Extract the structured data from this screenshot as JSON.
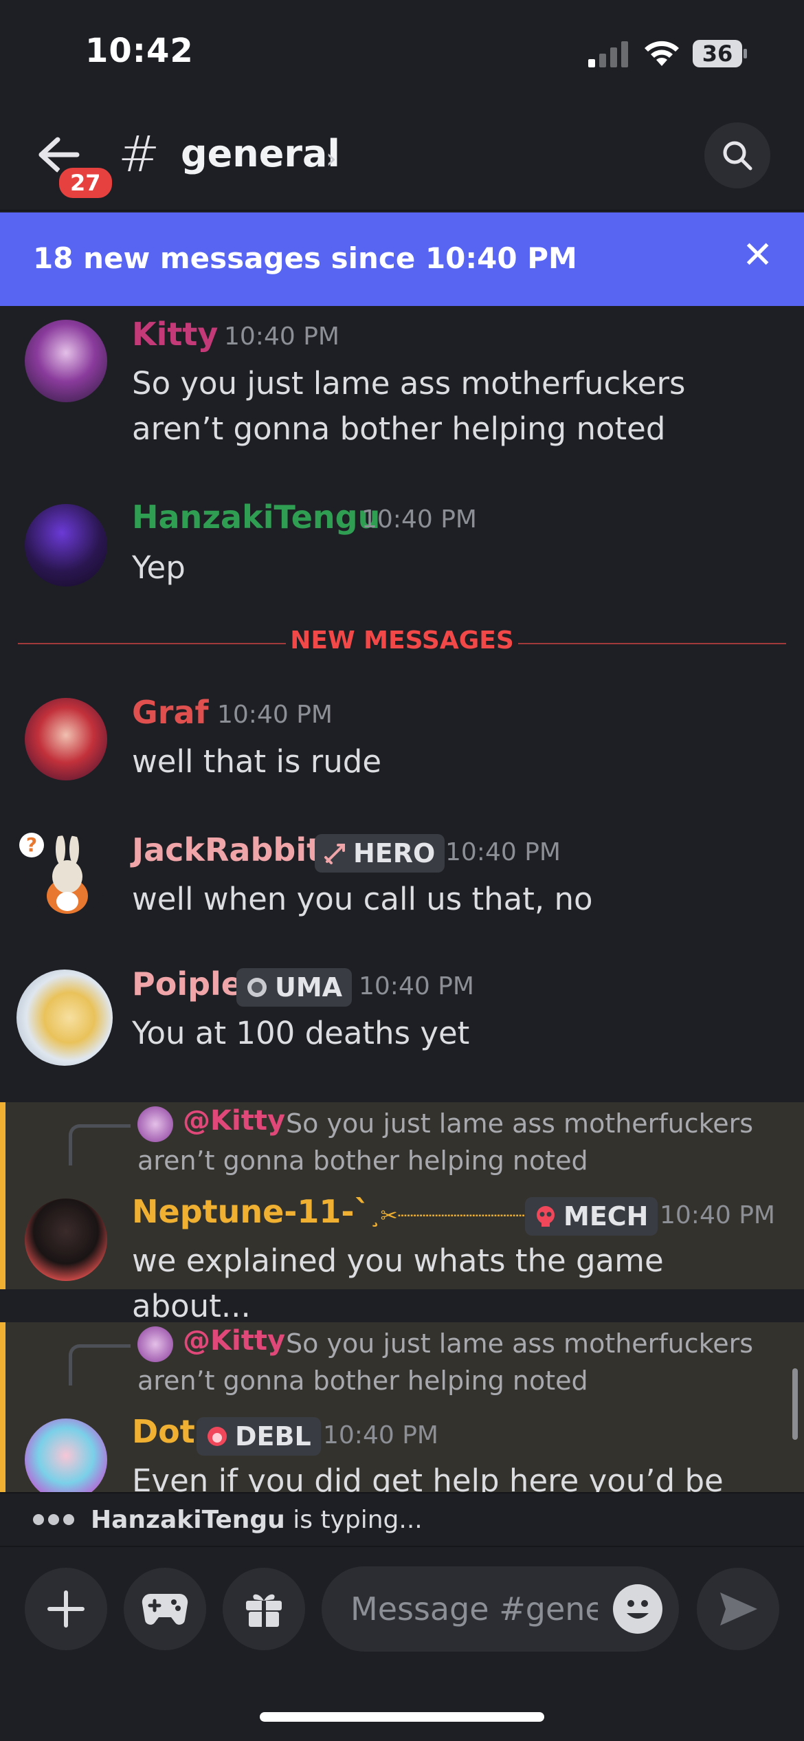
{
  "status_bar": {
    "time": "10:42",
    "battery": "36"
  },
  "header": {
    "unread_count": "27",
    "hash": "#",
    "channel_name": "general",
    "chevron": "›"
  },
  "banner": {
    "text": "18 new messages since 10:40 PM",
    "close": "✕"
  },
  "divider": {
    "label": "NEW MESSAGES"
  },
  "messages": [
    {
      "author": "Kitty",
      "color": "#c43a78",
      "time": "10:40 PM",
      "text": "So you just lame ass motherfuckers aren’t gonna bother helping noted"
    },
    {
      "author": "HanzakiTengu",
      "color": "#2f9e53",
      "time": "10:40 PM",
      "text": "Yep"
    },
    {
      "author": "Graf",
      "color": "#e0504e",
      "time": "10:40 PM",
      "text": "well that is rude"
    },
    {
      "author": "JackRabbit",
      "color": "#f0a5a9",
      "role": "HERO",
      "time": "10:40 PM",
      "text": "well when you call us that, no"
    },
    {
      "author": "Poiple",
      "color": "#f0a5a9",
      "role": "UMA",
      "time": "10:40 PM",
      "text": "You at 100 deaths yet"
    },
    {
      "reply": {
        "mention": "@Kitty",
        "text": "So you just lame ass motherfuckers aren’t gonna bother helping noted"
      },
      "author": "Neptune-11-`",
      "author_suffix": "¸✂┈┈┈┈┈┈┈┈┈┈┈┈┈",
      "color": "#f0b132",
      "role": "MECH",
      "time": "10:40 PM",
      "text": "we explained you whats the game about..."
    },
    {
      "reply": {
        "mention": "@Kitty",
        "text": "So you just lame ass motherfuckers aren’t gonna bother helping noted"
      },
      "author": "Dot",
      "color": "#f0b132",
      "role": "DEBL",
      "time": "10:40 PM",
      "text": "Even if you did get help here you’d be back"
    }
  ],
  "typing": {
    "user": "HanzakiTengu",
    "suffix": " is typing..."
  },
  "input": {
    "placeholder": "Message #gene..."
  },
  "colors": {
    "accent": "#5865f2",
    "background": "#1e1f24",
    "mention_highlight": "#34322c",
    "new_messages_red": "#f24848"
  }
}
